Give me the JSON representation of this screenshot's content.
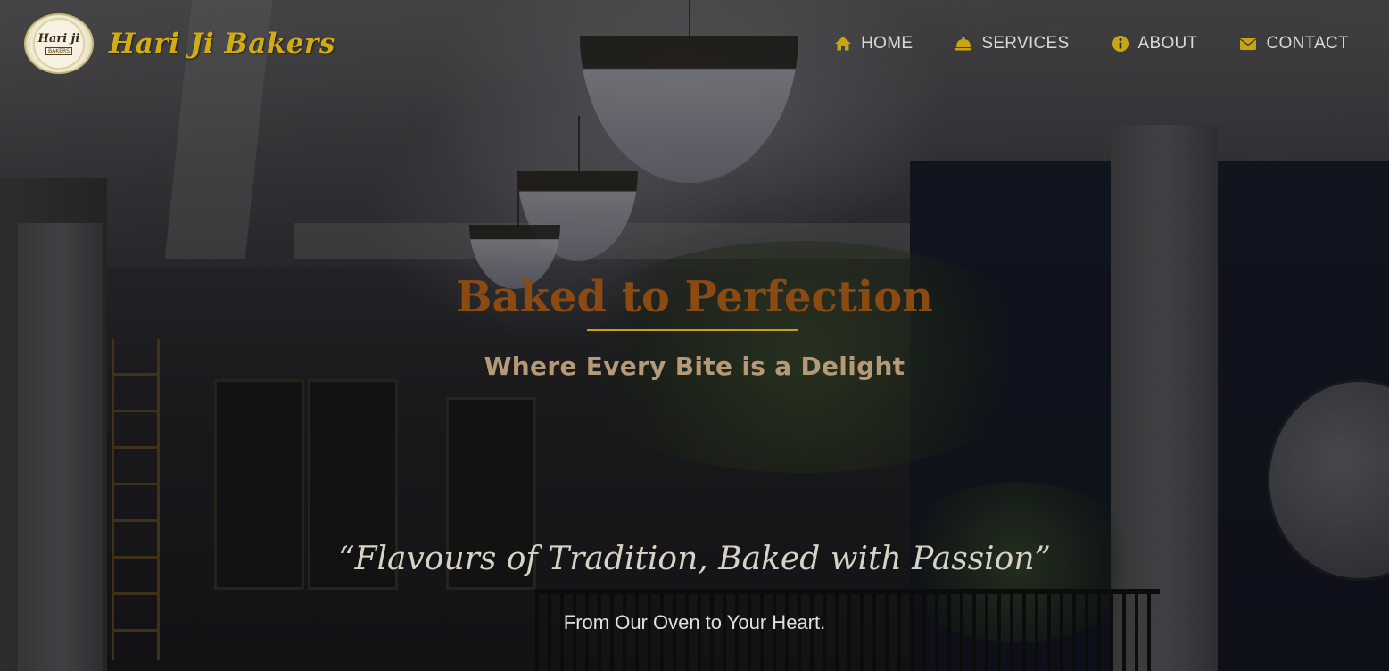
{
  "brand": {
    "logo_text": "Hari ji",
    "logo_subtext": "BAKERS",
    "name": "Hari Ji Bakers"
  },
  "nav": {
    "items": [
      {
        "label": "HOME",
        "icon": "home-icon"
      },
      {
        "label": "SERVICES",
        "icon": "bell-icon"
      },
      {
        "label": "ABOUT",
        "icon": "info-icon"
      },
      {
        "label": "CONTACT",
        "icon": "envelope-icon"
      }
    ]
  },
  "hero": {
    "title": "Baked to Perfection",
    "subtitle": "Where Every Bite is a Delight",
    "quote": "“Flavours of Tradition, Baked with Passion”",
    "tagline": "From Our Oven to Your Heart."
  },
  "colors": {
    "brand_gold": "#d2ac16",
    "title_brown": "#8a4a12",
    "nav_icon_gold": "#c9a514",
    "nav_text": "#d9d9d9"
  }
}
